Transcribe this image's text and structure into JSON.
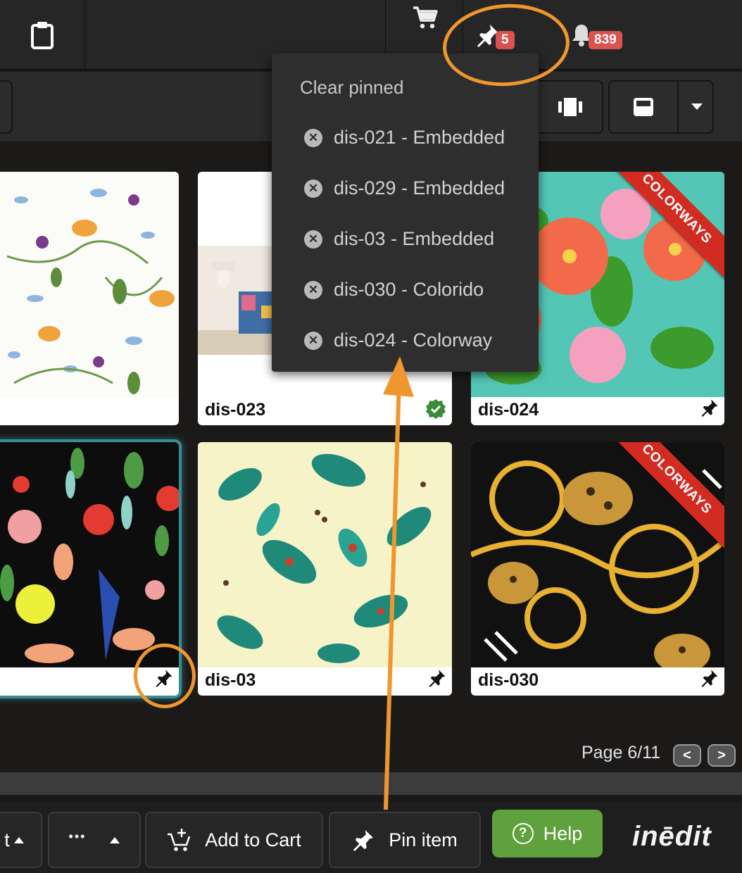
{
  "topbar": {
    "pinned_count": "5",
    "notifications_count": "839"
  },
  "dropdown": {
    "header": "Clear pinned",
    "items": [
      {
        "label": "dis-021 - Embedded"
      },
      {
        "label": "dis-029 - Embedded"
      },
      {
        "label": "dis-03 - Embedded"
      },
      {
        "label": "dis-030 - Colorido"
      },
      {
        "label": "dis-024 - Colorway"
      }
    ]
  },
  "cards": [
    {
      "id": "card-0",
      "caption": ""
    },
    {
      "id": "dis-023",
      "caption": "dis-023"
    },
    {
      "id": "dis-024",
      "caption": "dis-024",
      "ribbon": "COLORWAYS"
    },
    {
      "id": "card-3",
      "caption": ""
    },
    {
      "id": "dis-03",
      "caption": "dis-03"
    },
    {
      "id": "dis-030",
      "caption": "dis-030",
      "ribbon": "COLORWAYS"
    }
  ],
  "pager": {
    "label": "Page 6/11",
    "prev": "<",
    "next": ">"
  },
  "bottom": {
    "partial_label": "t",
    "more_label": "•••",
    "add_to_cart": "Add to Cart",
    "pin_item": "Pin item",
    "help": "Help",
    "logo": "inēdit"
  },
  "colors": {
    "accent": "#f0962e",
    "badge": "#d9534f",
    "help": "#5fa13d",
    "ribbon": "#d22b22"
  }
}
